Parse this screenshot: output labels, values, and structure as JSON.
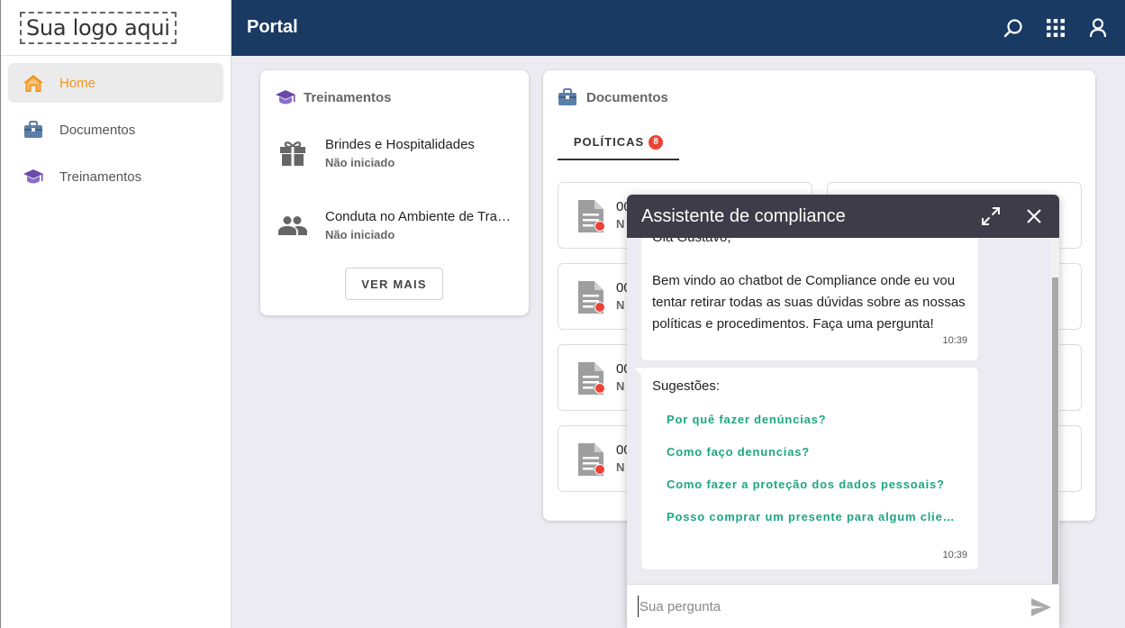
{
  "logo": {
    "text": "Sua logo aqui"
  },
  "sidebar": {
    "items": [
      {
        "label": "Home",
        "icon": "home-icon",
        "active": true
      },
      {
        "label": "Documentos",
        "icon": "briefcase-icon",
        "active": false
      },
      {
        "label": "Treinamentos",
        "icon": "graduation-cap-icon",
        "active": false
      }
    ]
  },
  "topbar": {
    "title": "Portal",
    "icons": [
      "search-icon",
      "apps-grid-icon",
      "user-icon"
    ]
  },
  "treinamentos": {
    "title": "Treinamentos",
    "items": [
      {
        "name": "Brindes e Hospitalidades",
        "status": "Não iniciado",
        "icon": "gift-icon"
      },
      {
        "name": "Conduta no Ambiente de Trabalho",
        "status": "Não iniciado",
        "icon": "people-icon"
      }
    ],
    "ver_mais": "VER MAIS"
  },
  "documentos": {
    "title": "Documentos",
    "tab": {
      "label": "POLÍTICAS",
      "badge": "8"
    },
    "items": [
      {
        "t1": "00",
        "t2": "N"
      },
      {
        "t1": "00",
        "t2": "N"
      },
      {
        "t1": "00",
        "t2": "N"
      },
      {
        "t1": "00",
        "t2": "N"
      }
    ]
  },
  "chat": {
    "title": "Assistente de compliance",
    "greeting": "Olá Gustavo,",
    "welcome": "Bem vindo ao chatbot de Compliance onde eu vou tentar retirar todas as suas dúvidas sobre as nossas políticas e procedimentos. Faça uma pergunta!",
    "welcome_time": "10:39",
    "suggestions_label": "Sugestões:",
    "suggestions": [
      "Por quê fazer denúncias?",
      "Como faço denuncias?",
      "Como fazer a proteção dos dados pessoais?",
      "Posso comprar um presente para algum cliente?"
    ],
    "suggestions_time": "10:39",
    "input_placeholder": "Sua pergunta"
  },
  "colors": {
    "topbar": "#193a63",
    "active_nav": "#f0961e",
    "chat_header": "#3d3c48",
    "suggestion": "#1ea682",
    "badge": "#ea4335"
  }
}
